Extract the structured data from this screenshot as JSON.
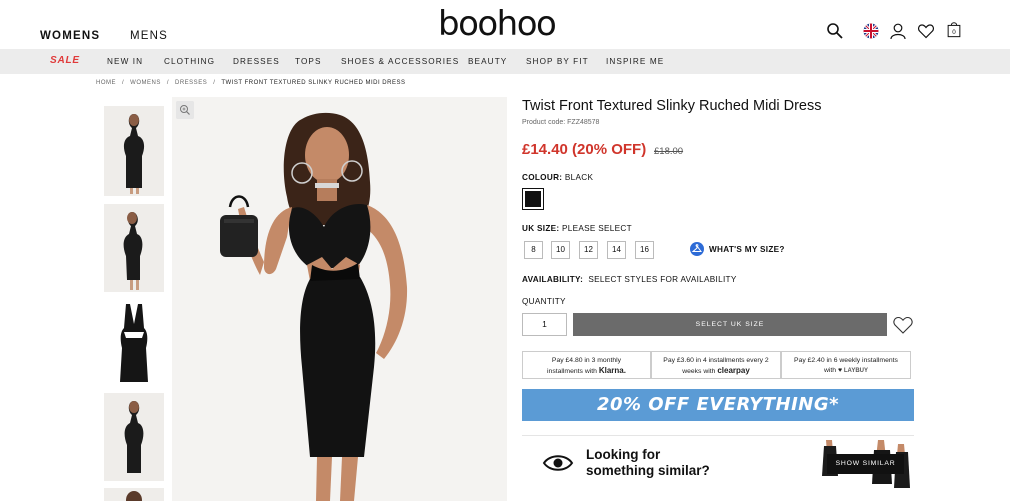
{
  "header": {
    "tabs": [
      {
        "label": "WOMENS",
        "active": true
      },
      {
        "label": "MENS",
        "active": false
      }
    ],
    "logo": "boohoo",
    "icons": [
      "search-icon",
      "uk-flag-icon",
      "account-icon",
      "wishlist-icon",
      "bag-icon"
    ],
    "bag_count": "0"
  },
  "nav": {
    "sale_label": "SALE",
    "items": [
      "NEW IN",
      "CLOTHING",
      "DRESSES",
      "TOPS",
      "SHOES & ACCESSORIES",
      "BEAUTY",
      "SHOP BY FIT",
      "INSPIRE ME"
    ]
  },
  "breadcrumb": [
    "HOME",
    "WOMENS",
    "DRESSES",
    "TWIST FRONT TEXTURED SLINKY RUCHED MIDI DRESS"
  ],
  "product": {
    "title": "Twist Front Textured Slinky Ruched Midi Dress",
    "code": "Product code: FZZ48578",
    "price": "£14.40 (20% OFF)",
    "was_price": "£18.00",
    "colour_label": "COLOUR:",
    "colour_value": "BLACK",
    "colour_swatch": "#111111",
    "size_label": "UK SIZE:",
    "size_value": "PLEASE SELECT",
    "sizes": [
      "8",
      "10",
      "12",
      "14",
      "16"
    ],
    "whats_my_size": "WHAT'S MY SIZE?",
    "availability_label": "AVAILABILITY:",
    "availability_value": "SELECT STYLES FOR AVAILABILITY",
    "quantity_label": "QUANTITY",
    "quantity_value": "1",
    "add_button": "SELECT UK SIZE"
  },
  "payments": [
    {
      "line1": "Pay £4.80 in 3 monthly",
      "line2": "installments with",
      "brand": "Klarna."
    },
    {
      "line1": "Pay £3.60 in 4 installments every 2",
      "line2": "weeks with",
      "brand": "clearpay"
    },
    {
      "line1": "Pay £2.40 in 6 weekly installments",
      "line2": "with",
      "brand": "LAYBUY"
    }
  ],
  "banner": "20% OFF EVERYTHING*",
  "similar": {
    "line1": "Looking for",
    "line2": "something similar?",
    "button": "SHOW SIMILAR"
  },
  "colors": {
    "price_red": "#d0352b",
    "sale_red": "#e03a3a",
    "banner_blue": "#5b9bd5",
    "button_grey": "#6b6b6b"
  }
}
